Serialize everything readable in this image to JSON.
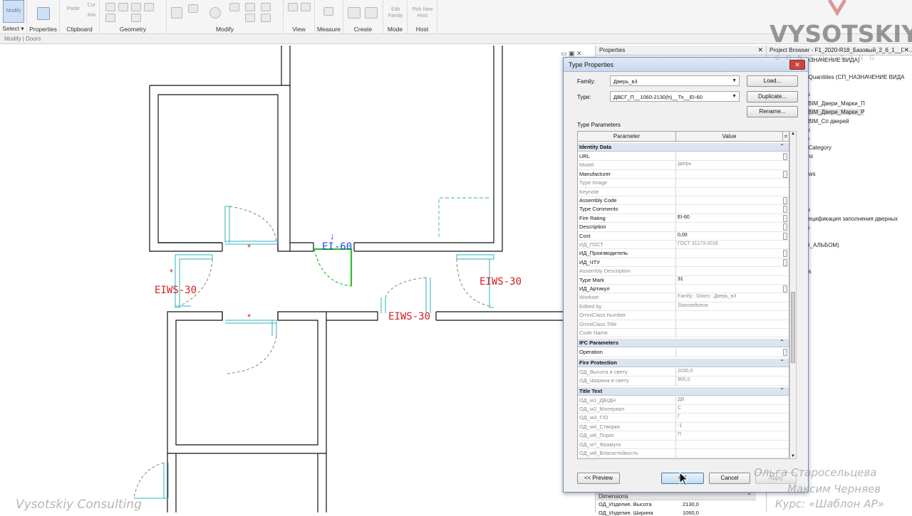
{
  "ribbon": {
    "groups": [
      {
        "id": "select",
        "label": "Select",
        "tool": "Modify"
      },
      {
        "id": "properties",
        "label": "Properties"
      },
      {
        "id": "clipboard",
        "label": "Clipboard",
        "tools": [
          "Paste",
          "Cut",
          "Join"
        ]
      },
      {
        "id": "geometry",
        "label": "Geometry"
      },
      {
        "id": "modify",
        "label": "Modify"
      },
      {
        "id": "view",
        "label": "View"
      },
      {
        "id": "measure",
        "label": "Measure"
      },
      {
        "id": "create",
        "label": "Create"
      },
      {
        "id": "mode",
        "label": "Mode",
        "tool": "Edit Family"
      },
      {
        "id": "host",
        "label": "Host",
        "tool": "Pick New Host"
      }
    ]
  },
  "context_bar": "Modify | Doors",
  "drawing": {
    "tags": [
      "EI-60",
      "EIWS-30",
      "EIWS-30",
      "EIWS-30"
    ],
    "star": "*",
    "arrow": "↓"
  },
  "properties_palette": {
    "title": "Properties",
    "section": "Dimensions",
    "rows": [
      {
        "name": "ОД_Изделие. Высота",
        "value": "2130,0"
      },
      {
        "name": "ОД_Изделие. Ширина",
        "value": "1060,0"
      }
    ]
  },
  "project_browser": {
    "title": "Project Browser - F1_2020-R18_Базовый_2_6_1__00...",
    "items": [
      "НАЗНАЧЕНИЕ ВИДА)",
      "es/Quantities (СП_НАЗНАЧЕНИЕ ВИДА",
      "ors",
      "BIM_Двери_Марки_П",
      "BIM_Двери_Марки_Р",
      "BIM_Сп дверей",
      "ors",
      "els",
      "lti-Category",
      "oms",
      "lls",
      "dows",
      "ors",
      "Спецификация заполнения дверных",
      "ets",
      "lls",
      "ЛВ_АЛЬБОМ)",
      "nks"
    ]
  },
  "dialog": {
    "title": "Type Properties",
    "close": "✕",
    "family_label": "Family:",
    "family_value": "Дверь_в3",
    "type_label": "Type:",
    "type_value": "ДВСГ_П__1060-2130(h)__Тх__EI-60",
    "load_label": "Load...",
    "duplicate_label": "Duplicate...",
    "rename_label": "Rename...",
    "type_params_label": "Type Parameters",
    "col_param": "Parameter",
    "col_value": "Value",
    "col_eq": "=",
    "groups": [
      {
        "name": "Identity Data",
        "rows": [
          {
            "name": "URL",
            "value": "",
            "grey": false,
            "btn": true
          },
          {
            "name": "Model",
            "value": "дверь",
            "grey": true,
            "btn": false
          },
          {
            "name": "Manufacturer",
            "value": "",
            "grey": false,
            "btn": true
          },
          {
            "name": "Type Image",
            "value": "",
            "grey": true,
            "btn": false
          },
          {
            "name": "Keynote",
            "value": "-",
            "grey": true,
            "btn": false
          },
          {
            "name": "Assembly Code",
            "value": "",
            "grey": false,
            "btn": true
          },
          {
            "name": "Type Comments",
            "value": "",
            "grey": false,
            "btn": true
          },
          {
            "name": "Fire Rating",
            "value": "EI-60",
            "grey": false,
            "btn": true
          },
          {
            "name": "Description",
            "value": "",
            "grey": false,
            "btn": true
          },
          {
            "name": "Cost",
            "value": "0,00",
            "grey": false,
            "btn": true
          },
          {
            "name": "ИД_ГОСТ",
            "value": "ГОСТ 31173-2016",
            "grey": true,
            "btn": false
          },
          {
            "name": "ИД_Производитель",
            "value": "",
            "grey": false,
            "btn": true
          },
          {
            "name": "ИД_ЧТУ",
            "value": "",
            "grey": false,
            "btn": true
          },
          {
            "name": "Assembly Description",
            "value": "",
            "grey": true,
            "btn": false
          },
          {
            "name": "Type Mark",
            "value": "31",
            "grey": false,
            "btn": false
          },
          {
            "name": "ИД_Артикул",
            "value": "",
            "grey": false,
            "btn": true
          },
          {
            "name": "Workset",
            "value": "Family : Doors : Дверь_в3",
            "grey": true,
            "btn": false
          },
          {
            "name": "Edited by",
            "value": "Staroseltceva",
            "grey": true,
            "btn": false
          },
          {
            "name": "OmniClass Number",
            "value": "",
            "grey": true,
            "btn": false
          },
          {
            "name": "OmniClass Title",
            "value": "",
            "grey": true,
            "btn": false
          },
          {
            "name": "Code Name",
            "value": "",
            "grey": true,
            "btn": false
          }
        ]
      },
      {
        "name": "IFC Parameters",
        "rows": [
          {
            "name": "Operation",
            "value": "",
            "grey": false,
            "btn": true
          }
        ]
      },
      {
        "name": "Fire Protection",
        "rows": [
          {
            "name": "ОД_Высота в свету",
            "value": "2030,0",
            "grey": true,
            "btn": false
          },
          {
            "name": "ОД_Ширина в свету",
            "value": "900,0",
            "grey": true,
            "btn": false
          }
        ]
      },
      {
        "name": "Title Text",
        "rows": [
          {
            "name": "ОД_м1_ДВ/ДН",
            "value": "ДВ",
            "grey": true,
            "btn": false
          },
          {
            "name": "ОД_м2_Материал",
            "value": "С",
            "grey": true,
            "btn": false
          },
          {
            "name": "ОД_м3_Г/О",
            "value": "Г",
            "grey": true,
            "btn": false
          },
          {
            "name": "ОД_м4_Створки",
            "value": "-1",
            "grey": true,
            "btn": false
          },
          {
            "name": "ОД_м6_Порог",
            "value": "П",
            "grey": true,
            "btn": false
          },
          {
            "name": "ОД_м7_Фрамуга",
            "value": "",
            "grey": true,
            "btn": false
          },
          {
            "name": "ОД_м8_Влагостойкость",
            "value": "",
            "grey": true,
            "btn": false
          }
        ]
      }
    ],
    "preview_label": "<< Preview",
    "ok_label": "OK",
    "cancel_label": "Cancel",
    "apply_label": "Apply"
  },
  "watermarks": {
    "logo": "VYSOTSKIY",
    "logo_sub": "CONSULTING",
    "left": "Vysotskiy Consulting",
    "credits": [
      "Ольга Старосельцева",
      "Максим Черняев",
      "Курс: «Шаблон АР»"
    ]
  },
  "colors": {
    "accent": "#3c7fb1",
    "walls": "#111111",
    "door_swing": "#2bb3c0",
    "tag_red": "#d62020",
    "tag_blue": "#1f4bd8",
    "selected_door": "#2fbf2f"
  }
}
